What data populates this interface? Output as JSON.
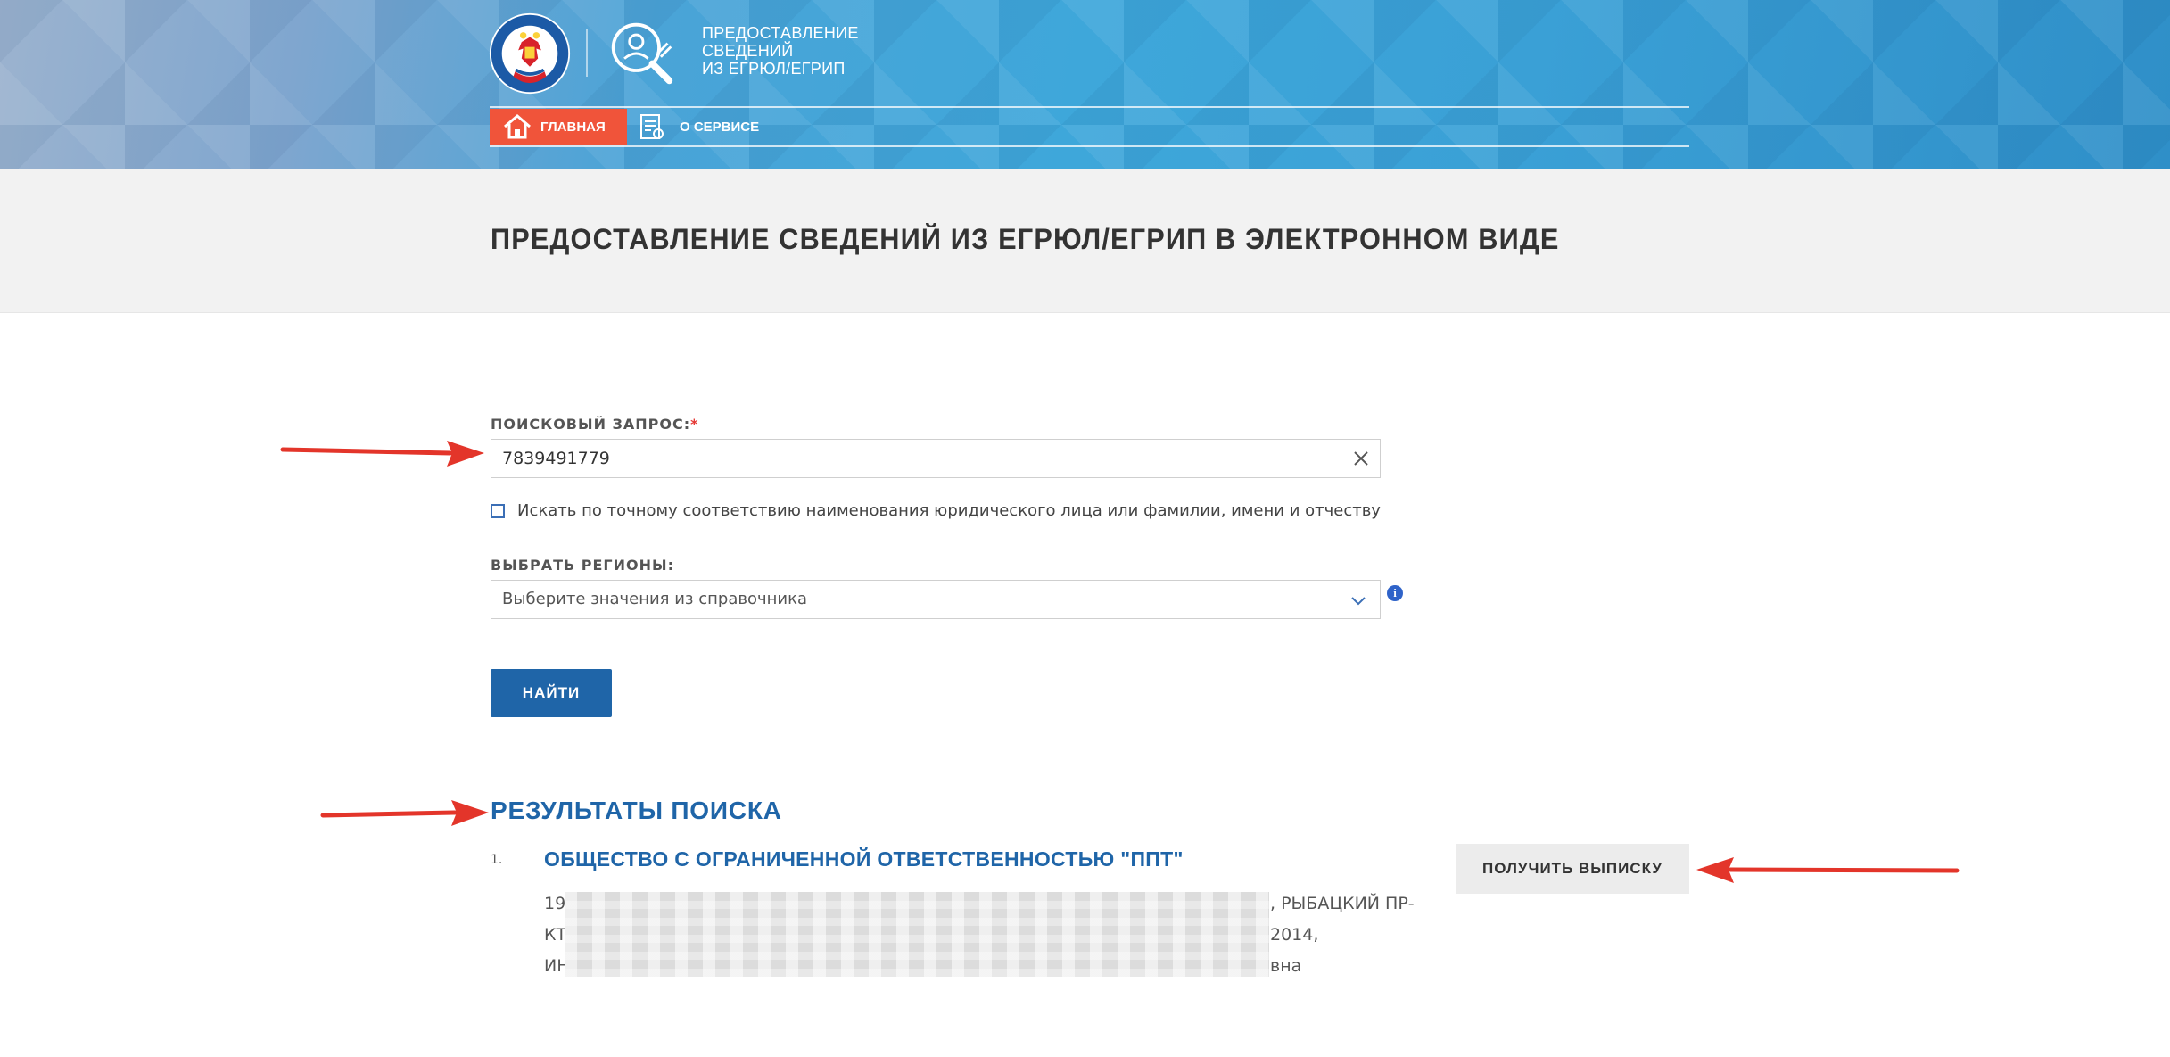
{
  "header": {
    "site_title_lines": [
      "ПРЕДОСТАВЛЕНИЕ",
      "СВЕДЕНИЙ",
      "ИЗ ЕГРЮЛ/ЕГРИП"
    ],
    "nav": {
      "home": "ГЛАВНАЯ",
      "about": "О СЕРВИСЕ"
    }
  },
  "page": {
    "title": "ПРЕДОСТАВЛЕНИЕ СВЕДЕНИЙ ИЗ ЕГРЮЛ/ЕГРИП В ЭЛЕКТРОННОМ ВИДЕ"
  },
  "form": {
    "query_label": "ПОИСКОВЫЙ ЗАПРОС:",
    "required_mark": "*",
    "query_value": "7839491779",
    "exact_match_label": "Искать по точному соответствию наименования юридического лица или фамилии, имени и отчеству",
    "exact_match_checked": false,
    "regions_label": "ВЫБРАТЬ РЕГИОНЫ:",
    "regions_placeholder": "Выберите значения из справочника",
    "info_symbol": "i",
    "submit_label": "НАЙТИ"
  },
  "results": {
    "title": "РЕЗУЛЬТАТЫ ПОИСКА",
    "items": [
      {
        "number": "1.",
        "name": "ОБЩЕСТВО С ОГРАНИЧЕННОЙ ОТВЕТСТВЕННОСТЬЮ \"ППТ\"",
        "button": "ПОЛУЧИТЬ ВЫПИСКУ",
        "details_visible": {
          "line1_start": "19",
          "line1_end": ", РЫБАЦКИЙ ПР-",
          "line2_start": "КТ,",
          "line2_end": "2014,",
          "line3_start": "ИН",
          "line3_end": "вна"
        }
      }
    ]
  },
  "colors": {
    "accent_orange": "#f0543a",
    "primary_blue": "#1f65a8",
    "annotation_arrow": "#e3352a"
  }
}
